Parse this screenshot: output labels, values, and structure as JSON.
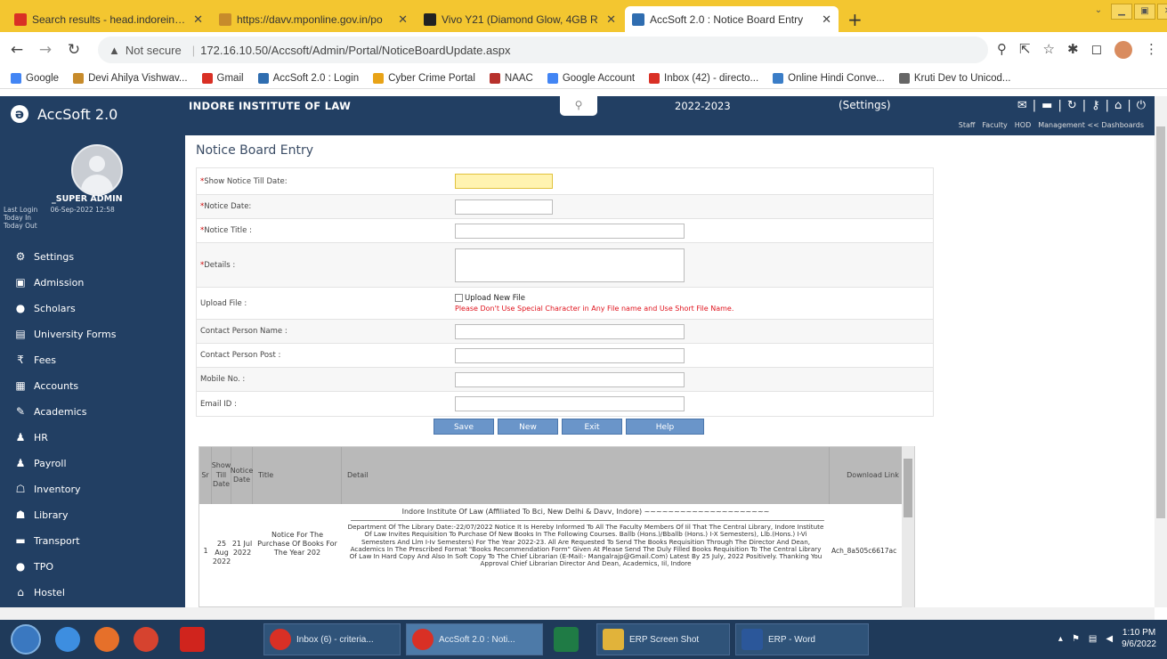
{
  "browser": {
    "tabs": [
      {
        "label": "Search results - head.indoreinstit",
        "icon": "gmail-icon",
        "color": "#d93025"
      },
      {
        "label": "https://davv.mponline.gov.in/po",
        "icon": "davv-icon",
        "color": "#c78b2b"
      },
      {
        "label": "Vivo Y21 (Diamond Glow, 4GB R",
        "icon": "amazon-icon",
        "color": "#222222"
      },
      {
        "label": "AccSoft 2.0 : Notice Board Entry",
        "icon": "accsoft-icon",
        "color": "#2f6db0"
      }
    ],
    "new_tab": "+",
    "url_warning": "Not secure",
    "url": "172.16.10.50/Accsoft/Admin/Portal/NoticeBoardUpdate.aspx",
    "bookmarks": [
      {
        "label": "Google",
        "color": "#4285f4"
      },
      {
        "label": "Devi Ahilya Vishwav...",
        "color": "#c78b2b"
      },
      {
        "label": "Gmail",
        "color": "#d93025"
      },
      {
        "label": "AccSoft 2.0 : Login",
        "color": "#2f6db0"
      },
      {
        "label": "Cyber Crime Portal",
        "color": "#e8a317"
      },
      {
        "label": "NAAC",
        "color": "#b7312c"
      },
      {
        "label": "Google Account",
        "color": "#4285f4"
      },
      {
        "label": "Inbox (42) - directo...",
        "color": "#d93025"
      },
      {
        "label": "Online Hindi Conve...",
        "color": "#3a7dc7"
      },
      {
        "label": "Kruti Dev to Unicod...",
        "color": "#666666"
      }
    ]
  },
  "header": {
    "app_name": "AccSoft 2.0",
    "institute": "INDORE INSTITUTE OF LAW",
    "session": "2022-2023",
    "settings": "(Settings)",
    "links": [
      "Staff",
      "Faculty",
      "HOD",
      "Management << Dashboards"
    ]
  },
  "user": {
    "name": "_SUPER ADMIN",
    "last_login_label": "Last Login",
    "last_login_value": "06-Sep-2022 12:58",
    "today_in": "Today In",
    "today_out": "Today Out"
  },
  "sidebar": {
    "items": [
      {
        "label": "Settings",
        "icon": "gear-icon",
        "glyph": "⚙"
      },
      {
        "label": "Admission",
        "icon": "admission-icon",
        "glyph": "▣"
      },
      {
        "label": "Scholars",
        "icon": "user-icon",
        "glyph": "●"
      },
      {
        "label": "University Forms",
        "icon": "form-icon",
        "glyph": "▤"
      },
      {
        "label": "Fees",
        "icon": "rupee-icon",
        "glyph": "₹"
      },
      {
        "label": "Accounts",
        "icon": "calculator-icon",
        "glyph": "▦"
      },
      {
        "label": "Academics",
        "icon": "pencil-icon",
        "glyph": "✎"
      },
      {
        "label": "HR",
        "icon": "users-icon",
        "glyph": "♟"
      },
      {
        "label": "Payroll",
        "icon": "payroll-icon",
        "glyph": "♟"
      },
      {
        "label": "Inventory",
        "icon": "inventory-icon",
        "glyph": "☖"
      },
      {
        "label": "Library",
        "icon": "library-icon",
        "glyph": "☗"
      },
      {
        "label": "Transport",
        "icon": "bus-icon",
        "glyph": "▬"
      },
      {
        "label": "TPO",
        "icon": "tpo-icon",
        "glyph": "●"
      },
      {
        "label": "Hostel",
        "icon": "home-icon",
        "glyph": "⌂"
      }
    ]
  },
  "page": {
    "title": "Notice Board Entry",
    "fields": {
      "show_till": "Show Notice Till Date:",
      "notice_date": "Notice Date:",
      "notice_title": "Notice Title :",
      "details": "Details :",
      "upload_file": "Upload File :",
      "upload_checkbox": "Upload New File",
      "upload_warning": "Please Don't Use Special Character in Any File name and Use Short File Name.",
      "contact_name": "Contact Person Name :",
      "contact_post": "Contact Person Post :",
      "mobile": "Mobile No. :",
      "email": "Email ID :"
    },
    "buttons": {
      "save": "Save",
      "new": "New",
      "exit": "Exit",
      "help": "Help"
    },
    "grid": {
      "headers": {
        "sr": "Sr",
        "show_till": "Show Till Date",
        "notice_date": "Notice Date",
        "title": "Title",
        "detail": "Detail",
        "download": "Download Link"
      },
      "rows": [
        {
          "sr": "1",
          "show_till": "25 Aug 2022",
          "notice_date": "21 Jul 2022",
          "title": "Notice For The Purchase Of Books For The Year 202",
          "detail_heading": "Indore Institute Of Law (Affiliated To Bci, New Delhi & Davv, Indore) ~~~~~~~~~~~~~~~~~~~~~",
          "detail": "Department Of The Library Date:-22/07/2022 Notice It Is Hereby Informed To All The Faculty Members Of Iil That The Central Library, Indore Institute Of Law Invites Requisition To Purchase Of New Books In The Following Courses. Ballb (Hons.)/Bballb (Hons.) I-X Semesters), Llb.(Hons.) I-Vi Semesters And Llm I-Iv Semesters) For The Year 2022-23. All Are Requested To Send The Books Requisition Through The Director And Dean, Academics In The Prescribed Format \"Books Recommendation Form\" Given At Please Send The Duly Filled Books Requisition To The Central Library Of Law In Hard Copy And Also In Soft Copy To The Chief Librarian (E-Mail:- Mangalrajp@Gmail.Com) Latest By 25 July, 2022 Positively. Thanking You Approval Chief Librarian Director And Dean, Academics, Iil, Indore",
          "download": "Ach_8a505c6617ac"
        }
      ]
    }
  },
  "taskbar": {
    "items": [
      {
        "label": "Inbox (6) - criteria...",
        "color": "#d93025"
      },
      {
        "label": "AccSoft 2.0 : Noti...",
        "color": "#d93025"
      },
      {
        "label": "ERP Screen Shot",
        "color": "#e1b33a"
      },
      {
        "label": "ERP - Word",
        "color": "#2b579a"
      }
    ],
    "time": "1:10 PM",
    "date": "9/6/2022"
  }
}
